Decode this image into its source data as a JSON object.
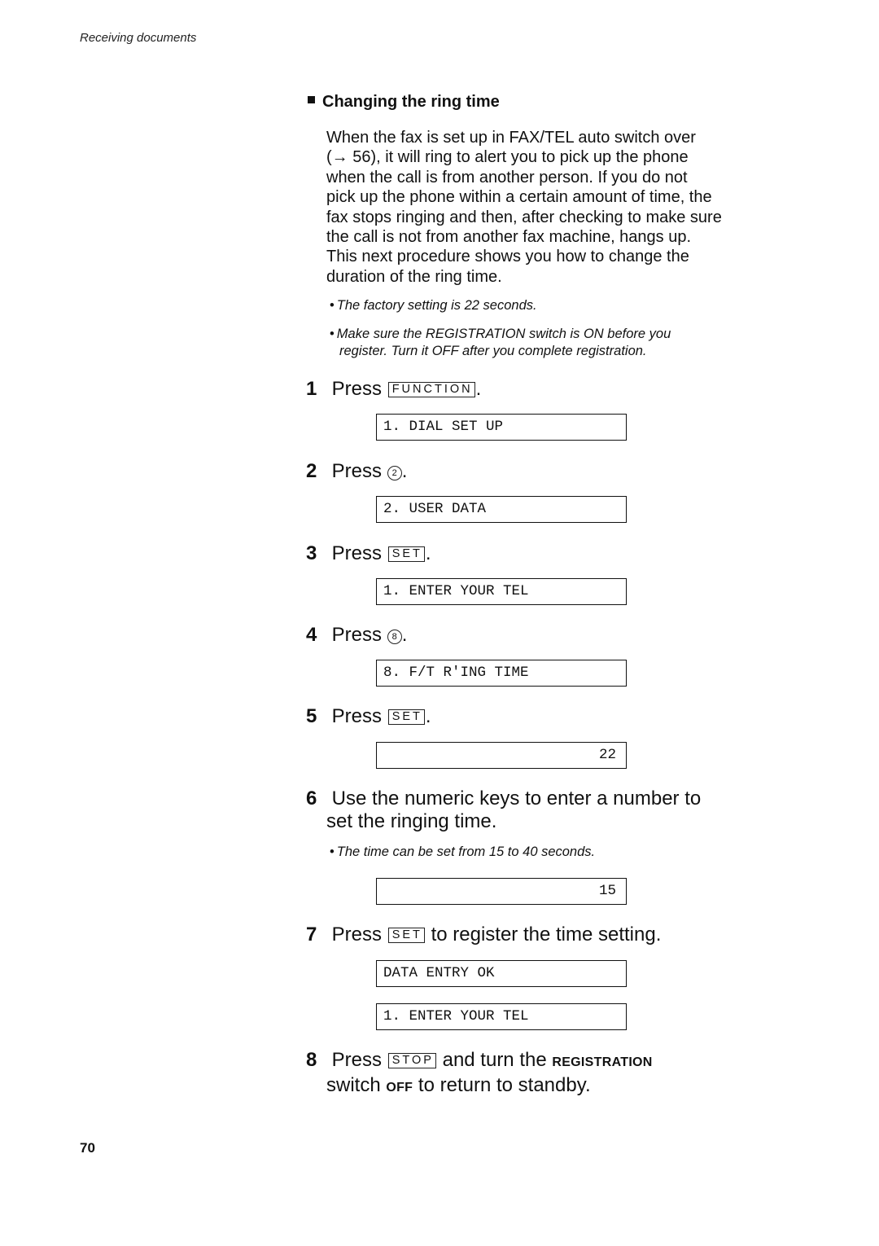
{
  "header": {
    "running_head": "Receiving documents"
  },
  "section": {
    "heading": "Changing the ring time",
    "intro_lines": [
      "When the fax is set up in FAX/TEL auto switch over",
      "(→ 56), it will ring to alert you to pick up the phone",
      "when the call is from another person.  If you do not",
      "pick up the phone within a certain amount of time, the",
      "fax stops ringing and then, after checking to make sure",
      "the call is not from another fax machine, hangs up.",
      "This next procedure shows you how to change the",
      "duration of the ring time."
    ],
    "notes": [
      {
        "line1": "The factory setting is 22 seconds."
      },
      {
        "line1": "Make sure the REGISTRATION switch is ON before you",
        "line2": "register.  Turn it OFF after you complete registration."
      }
    ]
  },
  "steps": [
    {
      "number": "1",
      "press": "Press",
      "key": "FUNCTION",
      "after": ".",
      "display": "1. DIAL SET UP"
    },
    {
      "number": "2",
      "press": "Press",
      "key": "2",
      "after": ".",
      "display": "2. USER DATA"
    },
    {
      "number": "3",
      "press": "Press",
      "key": "SET",
      "after": ".",
      "display": "1. ENTER YOUR TEL"
    },
    {
      "number": "4",
      "press": "Press",
      "key": "8",
      "after": ".",
      "display": "8. F/T R'ING TIME"
    },
    {
      "number": "5",
      "press": "Press",
      "key": "SET",
      "after": ".",
      "display": "22"
    },
    {
      "number": "6",
      "line1": "Use the numeric keys to enter a number to",
      "line2": "set the ringing time.",
      "note": "The time can be set from 15 to 40 seconds.",
      "display": "15"
    },
    {
      "number": "7",
      "press": "Press",
      "key": "SET",
      "after": " to register the time setting.",
      "display": "DATA ENTRY OK",
      "display2": "1. ENTER YOUR TEL"
    },
    {
      "number": "8",
      "press": "Press",
      "key": "STOP",
      "after": " and turn the ",
      "sc1": "REGISTRATION",
      "line2a": "switch ",
      "sc2": "OFF",
      "line2b": " to return to standby."
    }
  ],
  "footer": {
    "page_number": "70"
  },
  "glyphs": {
    "bullet": "•"
  }
}
